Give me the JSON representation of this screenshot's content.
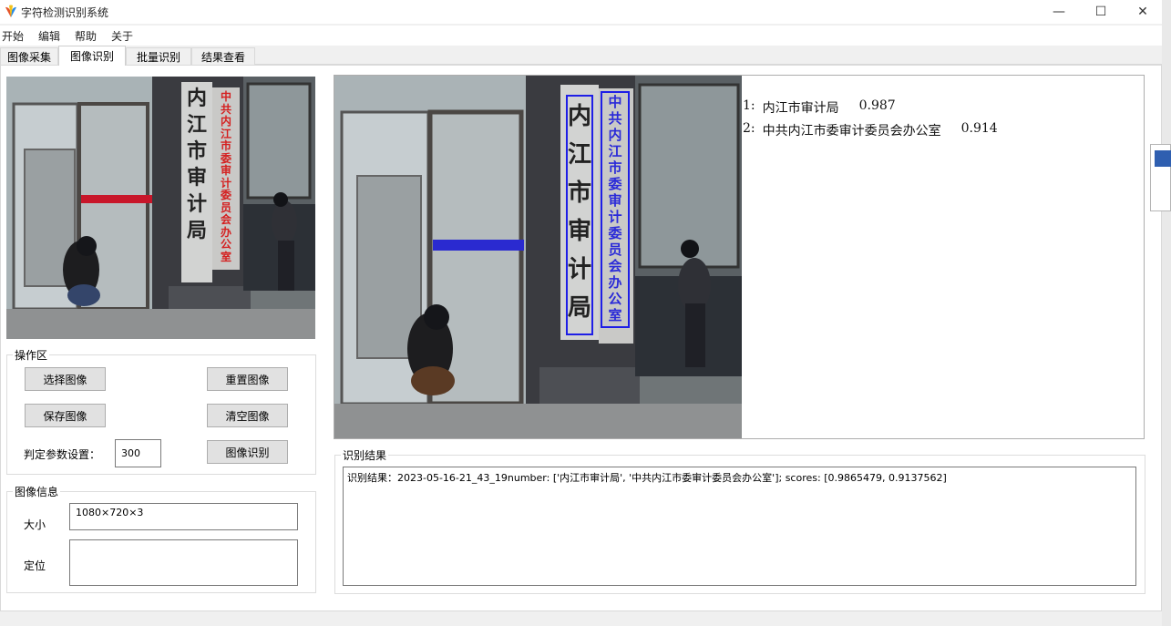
{
  "window": {
    "title": "字符检测识别系统",
    "controls": {
      "minimize": "—",
      "maximize": "☐",
      "close": "✕"
    }
  },
  "menu": [
    "开始",
    "编辑",
    "帮助",
    "关于"
  ],
  "tabs": [
    {
      "label": "图像采集",
      "active": false
    },
    {
      "label": "图像识别",
      "active": true
    },
    {
      "label": "批量识别",
      "active": false
    },
    {
      "label": "结果查看",
      "active": false
    }
  ],
  "photo": {
    "sign_left": [
      "内",
      "江",
      "市",
      "审",
      "计",
      "局"
    ],
    "sign_right": [
      "中",
      "共",
      "内",
      "江",
      "市",
      "委",
      "审",
      "计",
      "委",
      "员",
      "会",
      "办",
      "公",
      "室"
    ]
  },
  "operation": {
    "title": "操作区",
    "select_image": "选择图像",
    "reset_image": "重置图像",
    "save_image": "保存图像",
    "clear_image": "清空图像",
    "param_label": "判定参数设置：",
    "param_value": "300",
    "recognize": "图像识别"
  },
  "image_info": {
    "title": "图像信息",
    "size_label": "大小",
    "size_value": "1080×720×3",
    "position_label": "定位",
    "position_value": ""
  },
  "detections": [
    {
      "index": "1:",
      "text": "内江市审计局",
      "score": "0.987"
    },
    {
      "index": "2:",
      "text": "中共内江市委审计委员会办公室",
      "score": "0.914"
    }
  ],
  "result": {
    "title": "识别结果",
    "text": "识别结果：2023-05-16-21_43_19number: ['内江市审计局', '中共内江市委审计委员会办公室']; scores: [0.9865479, 0.9137562]"
  },
  "colors": {
    "detection_box": "#1e1ee6",
    "sign_red_text": "#d42020",
    "window_bg": "#f0f0f0"
  }
}
